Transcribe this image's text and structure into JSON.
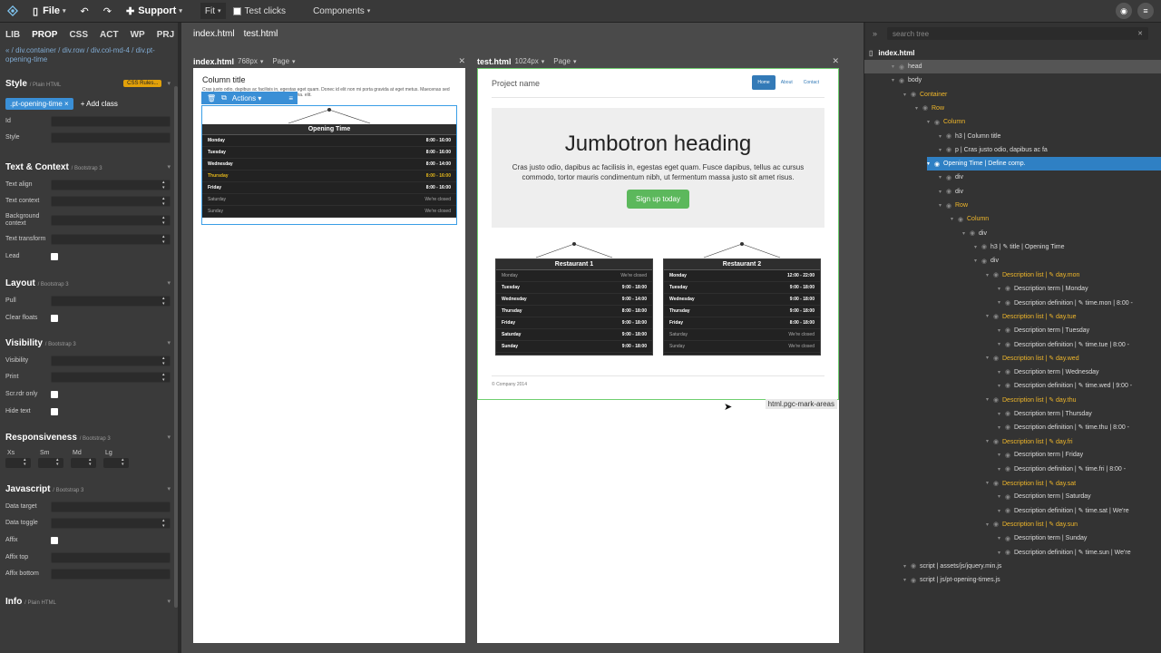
{
  "topbar": {
    "file": "File",
    "support": "Support",
    "fit": "Fit",
    "test_clicks": "Test clicks",
    "components": "Components"
  },
  "left": {
    "tabs": [
      "LIB",
      "PROP",
      "CSS",
      "ACT",
      "WP",
      "PRJ"
    ],
    "breadcrumb": "« / div.container / div.row / div.col-md-4 / div.pt-opening-time",
    "style": {
      "title": "Style",
      "sub": "/ Plain HTML",
      "badge": "CSS Rules...",
      "class_pill": ".pt-opening-time ×",
      "add_class": "+ Add class",
      "id": "Id",
      "style": "Style"
    },
    "text": {
      "title": "Text & Context",
      "sub": "/ Bootstrap 3",
      "align": "Text align",
      "context": "Text context",
      "bg": "Background context",
      "transform": "Text transform",
      "lead": "Lead"
    },
    "layout": {
      "title": "Layout",
      "sub": "/ Bootstrap 3",
      "pull": "Pull",
      "clear": "Clear floats"
    },
    "visibility": {
      "title": "Visibility",
      "sub": "/ Bootstrap 3",
      "vis": "Visibility",
      "print": "Print",
      "srdr": "Scr.rdr only",
      "hide": "Hide text"
    },
    "resp": {
      "title": "Responsiveness",
      "sub": "/ Bootstrap 3",
      "xs": "Xs",
      "sm": "Sm",
      "md": "Md",
      "lg": "Lg"
    },
    "js": {
      "title": "Javascript",
      "sub": "/ Bootstrap 3",
      "target": "Data target",
      "toggle": "Data toggle",
      "affix": "Affix",
      "top": "Affix top",
      "bottom": "Affix bottom"
    },
    "info": {
      "title": "Info",
      "sub": "/ Plain HTML"
    }
  },
  "center": {
    "file_tabs": [
      "index.html",
      "test.html"
    ],
    "paneA": {
      "file": "index.html",
      "size": "768px",
      "page": "Page",
      "col_title": "Column title",
      "lorem": "Cras justo odio, dapibus ac facilisis in, egestas eget quam. Donec id elit non mi porta gravida at eget metus. Maecenas sed diam eget risus varius blandit sit amet non magna. elit.",
      "actions": "Actions",
      "sign": {
        "title": "Opening Time",
        "rows": [
          [
            "Monday",
            "8:00 - 16:00"
          ],
          [
            "Tuesday",
            "8:00 - 16:00"
          ],
          [
            "Wednesday",
            "8:00 - 14:00"
          ],
          [
            "Thursday",
            "8:00 - 16:00"
          ],
          [
            "Friday",
            "8:00 - 16:00"
          ],
          [
            "Saturday",
            "We're closed"
          ],
          [
            "Sunday",
            "We're closed"
          ]
        ]
      }
    },
    "paneB": {
      "file": "test.html",
      "size": "1024px",
      "page": "Page",
      "project": "Project name",
      "nav": [
        "Home",
        "About",
        "Contact"
      ],
      "jumbo_h": "Jumbotron heading",
      "jumbo_p": "Cras justo odio, dapibus ac facilisis in, egestas eget quam. Fusce dapibus, tellus ac cursus commodo, tortor mauris condimentum nibh, ut fermentum massa justo sit amet risus.",
      "signup": "Sign up today",
      "footer": "© Company 2014",
      "mark": "html.pgc-mark-areas",
      "r1": {
        "title": "Restaurant 1",
        "rows": [
          [
            "Monday",
            "We're closed"
          ],
          [
            "Tuesday",
            "9:00 - 18:00"
          ],
          [
            "Wednesday",
            "9:00 - 14:00"
          ],
          [
            "Thursday",
            "8:00 - 18:00"
          ],
          [
            "Friday",
            "9:00 - 18:00"
          ],
          [
            "Saturday",
            "9:00 - 18:00"
          ],
          [
            "Sunday",
            "9:00 - 18:00"
          ]
        ]
      },
      "r2": {
        "title": "Restaurant 2",
        "rows": [
          [
            "Monday",
            "12:00 - 22:00"
          ],
          [
            "Tuesday",
            "9:00 - 18:00"
          ],
          [
            "Wednesday",
            "9:00 - 18:00"
          ],
          [
            "Thursday",
            "9:00 - 18:00"
          ],
          [
            "Friday",
            "8:00 - 18:00"
          ],
          [
            "Saturday",
            "We're closed"
          ],
          [
            "Sunday",
            "We're closed"
          ]
        ]
      }
    }
  },
  "tree": {
    "search": "search tree",
    "file": "index.html",
    "nodes": [
      {
        "t": "head",
        "d": 1,
        "hl": true
      },
      {
        "t": "body",
        "d": 1
      },
      {
        "t": "Container",
        "d": 2,
        "y": true
      },
      {
        "t": "Row",
        "d": 3,
        "y": true
      },
      {
        "t": "Column",
        "d": 4,
        "y": true
      },
      {
        "t": "h3 | Column title",
        "d": 5
      },
      {
        "t": "p | Cras justo odio, dapibus ac fa",
        "d": 5
      },
      {
        "t": "Opening Time | Define comp.",
        "d": 4,
        "sel": true
      },
      {
        "t": "div",
        "d": 5
      },
      {
        "t": "div",
        "d": 5
      },
      {
        "t": "Row",
        "d": 5,
        "y": true
      },
      {
        "t": "Column",
        "d": 6,
        "y": true
      },
      {
        "t": "div",
        "d": 7
      },
      {
        "t": "h3 | ✎ title | Opening Time",
        "d": 8
      },
      {
        "t": "div",
        "d": 8
      },
      {
        "t": "Description list | ✎ day.mon",
        "d": 9,
        "y": true
      },
      {
        "t": "Description term | Monday",
        "d": 10
      },
      {
        "t": "Description definition | ✎ time.mon | 8:00 -",
        "d": 10
      },
      {
        "t": "Description list | ✎ day.tue",
        "d": 9,
        "y": true
      },
      {
        "t": "Description term | Tuesday",
        "d": 10
      },
      {
        "t": "Description definition | ✎ time.tue | 8:00 -",
        "d": 10
      },
      {
        "t": "Description list | ✎ day.wed",
        "d": 9,
        "y": true
      },
      {
        "t": "Description term | Wednesday",
        "d": 10
      },
      {
        "t": "Description definition | ✎ time.wed | 9:00 -",
        "d": 10
      },
      {
        "t": "Description list | ✎ day.thu",
        "d": 9,
        "y": true
      },
      {
        "t": "Description term | Thursday",
        "d": 10
      },
      {
        "t": "Description definition | ✎ time.thu | 8:00 -",
        "d": 10
      },
      {
        "t": "Description list | ✎ day.fri",
        "d": 9,
        "y": true
      },
      {
        "t": "Description term | Friday",
        "d": 10
      },
      {
        "t": "Description definition | ✎ time.fri | 8:00 -",
        "d": 10
      },
      {
        "t": "Description list | ✎ day.sat",
        "d": 9,
        "y": true
      },
      {
        "t": "Description term | Saturday",
        "d": 10
      },
      {
        "t": "Description definition | ✎ time.sat | We're",
        "d": 10
      },
      {
        "t": "Description list | ✎ day.sun",
        "d": 9,
        "y": true
      },
      {
        "t": "Description term | Sunday",
        "d": 10
      },
      {
        "t": "Description definition | ✎ time.sun | We're",
        "d": 10
      },
      {
        "t": "script | assets/js/jquery.min.js",
        "d": 2
      },
      {
        "t": "script | js/pt-opening-times.js",
        "d": 2
      }
    ]
  }
}
